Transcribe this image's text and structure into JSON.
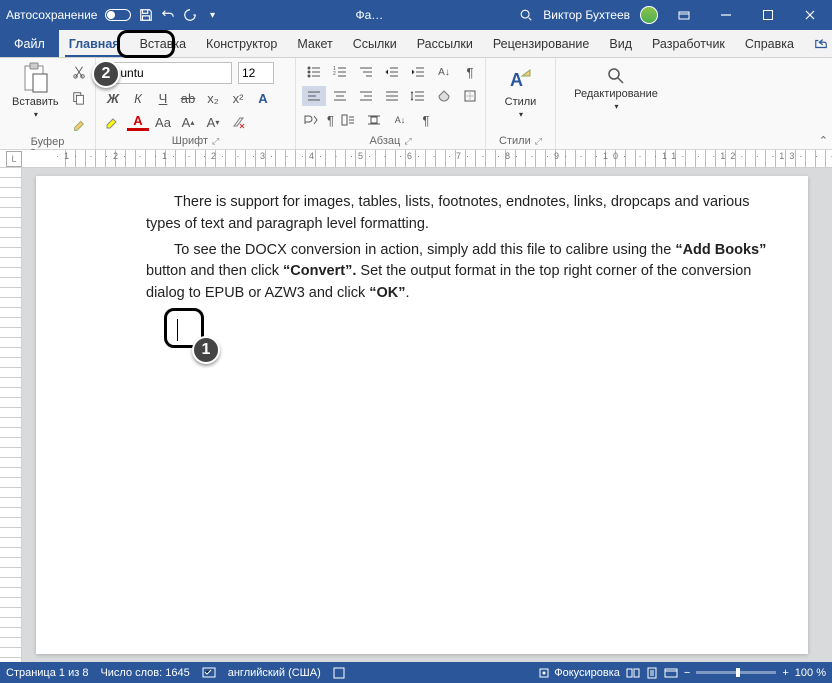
{
  "titlebar": {
    "autosave": "Автосохранение",
    "doc_title": "Фа…",
    "user": "Виктор Бухтеев"
  },
  "tabs": {
    "file": "Файл",
    "home": "Главная",
    "insert": "Вставка",
    "design": "Конструктор",
    "layout": "Макет",
    "references": "Ссылки",
    "mailings": "Рассылки",
    "review": "Рецензирование",
    "view": "Вид",
    "developer": "Разработчик",
    "help": "Справка",
    "share": "Поделиться"
  },
  "ribbon": {
    "clipboard": {
      "paste": "Вставить",
      "group": "Буфер обмена"
    },
    "font": {
      "name": "ubuntu",
      "size": "12",
      "group": "Шрифт"
    },
    "paragraph": {
      "group": "Абзац"
    },
    "styles": {
      "btn": "Стили",
      "group": "Стили"
    },
    "editing": {
      "btn": "Редактирование"
    }
  },
  "doc": {
    "p1": "There is support for images, tables, lists, footnotes, endnotes, links, dropcaps and various types of text and paragraph level formatting.",
    "p2a": "To see the DOCX conversion in action, simply add this file to calibre using the ",
    "p2b": "“Add Books”",
    "p2c": " button and then click ",
    "p2d": "“Convert”.",
    "p2e": "  Set the output format in the top right corner of the conversion dialog to EPUB or AZW3 and click ",
    "p2f": "“OK”",
    "p2g": "."
  },
  "status": {
    "page": "Страница 1 из 8",
    "words": "Число слов: 1645",
    "lang": "английский (США)",
    "focus": "Фокусировка",
    "zoom": "100 %"
  },
  "callouts": {
    "one": "1",
    "two": "2"
  }
}
